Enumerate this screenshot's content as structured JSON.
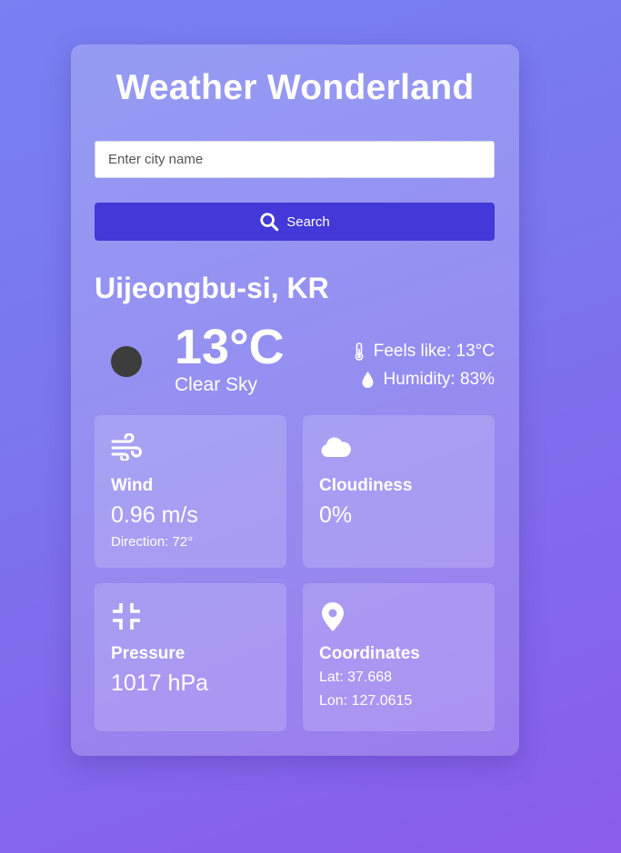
{
  "app": {
    "title": "Weather Wonderland"
  },
  "search": {
    "placeholder": "Enter city name",
    "value": "",
    "button_label": "Search"
  },
  "location": {
    "city": "Uijeongbu-si, KR"
  },
  "current": {
    "temperature": "13°C",
    "description": "Clear Sky",
    "feels_like": "Feels like: 13°C",
    "humidity": "Humidity: 83%"
  },
  "tiles": {
    "wind": {
      "label": "Wind",
      "value": "0.96 m/s",
      "direction": "Direction: 72°",
      "icon": "wind-icon"
    },
    "cloudiness": {
      "label": "Cloudiness",
      "value": "0%",
      "icon": "cloud-icon"
    },
    "pressure": {
      "label": "Pressure",
      "value": "1017 hPa",
      "icon": "compress-icon"
    },
    "coordinates": {
      "label": "Coordinates",
      "lat": "Lat: 37.668",
      "lon": "Lon: 127.0615",
      "icon": "map-pin-icon"
    }
  },
  "colors": {
    "background_start": "#7781f0",
    "background_end": "#8a5ce9",
    "button": "#4338d8",
    "weather_icon": "#3d3d3d"
  }
}
